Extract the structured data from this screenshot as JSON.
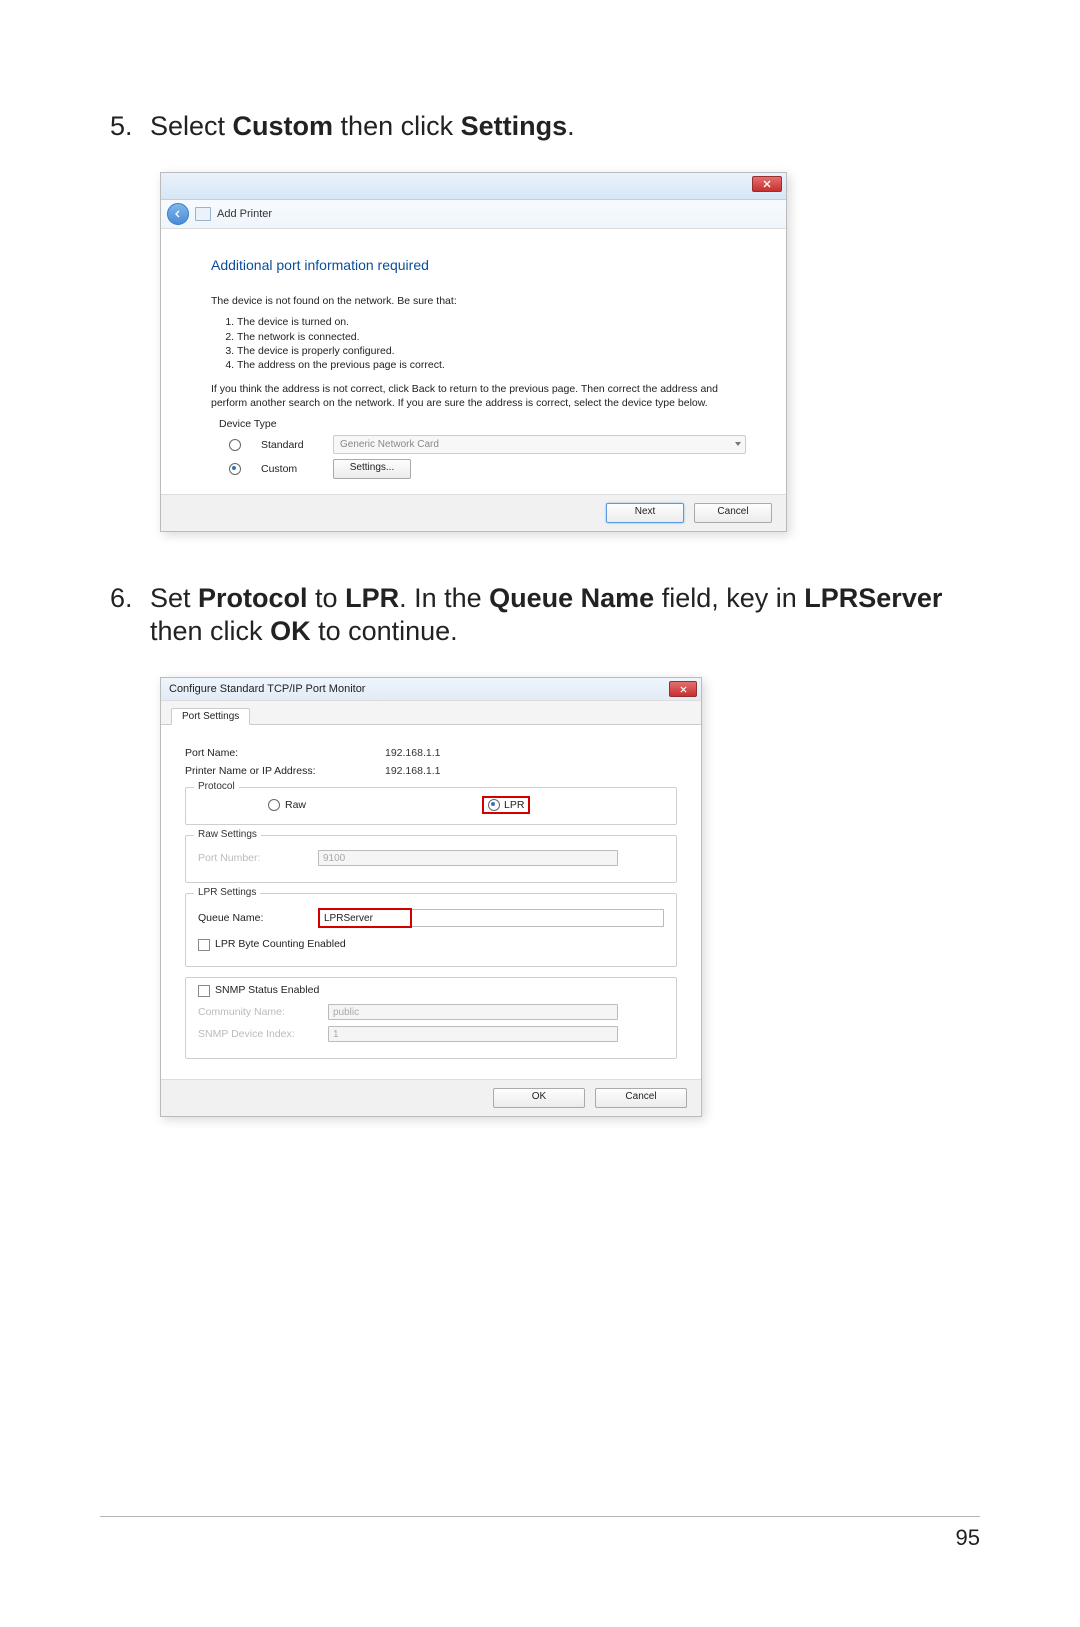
{
  "step5": {
    "num": "5.",
    "parts": [
      "Select ",
      "Custom",
      " then click ",
      "Settings",
      "."
    ]
  },
  "step6": {
    "num": "6.",
    "parts": [
      "Set ",
      "Protocol",
      " to ",
      "LPR",
      ". In the ",
      "Queue Name",
      " field, key in ",
      "LPRServer",
      " then click ",
      "OK",
      " to continue."
    ]
  },
  "win1": {
    "header": "Add Printer",
    "title": "Additional port information required",
    "notfound": "The device is not found on the network.  Be sure that:",
    "list": [
      "The device is turned on.",
      "The network is connected.",
      "The device is properly configured.",
      "The address on the previous page is correct."
    ],
    "note": "If you think the address is not correct, click Back to return to the previous page. Then correct the address and perform another search on the network. If you are sure the address is correct, select the device type below.",
    "devtype_label": "Device Type",
    "standard_label": "Standard",
    "combo_value": "Generic Network Card",
    "custom_label": "Custom",
    "settings_btn": "Settings...",
    "next_btn": "Next",
    "cancel_btn": "Cancel"
  },
  "win2": {
    "title": "Configure Standard TCP/IP Port Monitor",
    "tab": "Port Settings",
    "portname_lbl": "Port Name:",
    "portname_val": "192.168.1.1",
    "printer_lbl": "Printer Name or IP Address:",
    "printer_val": "192.168.1.1",
    "protocol_legend": "Protocol",
    "raw_label": "Raw",
    "lpr_label": "LPR",
    "raw_legend": "Raw Settings",
    "portnum_lbl": "Port Number:",
    "portnum_val": "9100",
    "lpr_legend": "LPR Settings",
    "queue_lbl": "Queue Name:",
    "queue_val": "LPRServer",
    "lprbyte_lbl": "LPR Byte Counting Enabled",
    "snmp_lbl": "SNMP Status Enabled",
    "comm_lbl": "Community Name:",
    "comm_val": "public",
    "idx_lbl": "SNMP Device Index:",
    "idx_val": "1",
    "ok_btn": "OK",
    "cancel_btn": "Cancel"
  },
  "page_number": "95"
}
